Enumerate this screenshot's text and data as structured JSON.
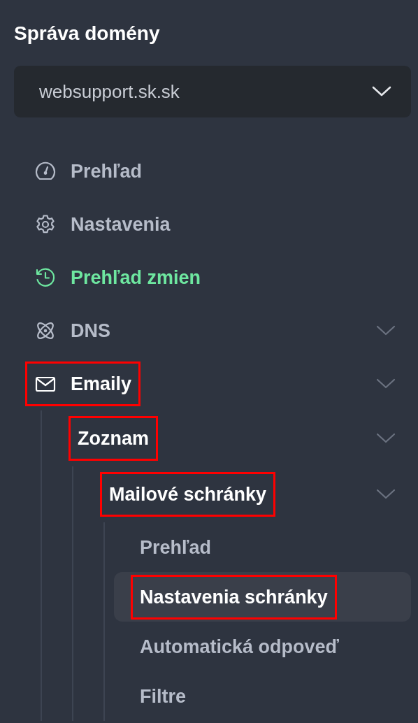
{
  "title": "Správa domény",
  "domain_select": {
    "value": "websupport.sk.sk"
  },
  "nav": {
    "items": [
      {
        "label": "Prehľad",
        "active": false,
        "expandable": false,
        "highlighted": false
      },
      {
        "label": "Nastavenia",
        "active": false,
        "expandable": false,
        "highlighted": false
      },
      {
        "label": "Prehľad zmien",
        "active": true,
        "expandable": false,
        "highlighted": false
      },
      {
        "label": "DNS",
        "active": false,
        "expandable": true,
        "highlighted": false
      },
      {
        "label": "Emaily",
        "active": false,
        "expandable": true,
        "highlighted": true,
        "children": [
          {
            "label": "Zoznam",
            "expandable": true,
            "highlighted": true,
            "children": [
              {
                "label": "Mailové schránky",
                "expandable": true,
                "highlighted": true,
                "children": [
                  {
                    "label": "Prehľad",
                    "selected": false,
                    "highlighted": false
                  },
                  {
                    "label": "Nastavenia schránky",
                    "selected": true,
                    "highlighted": true
                  },
                  {
                    "label": "Automatická odpoveď",
                    "selected": false,
                    "highlighted": false
                  },
                  {
                    "label": "Filtre",
                    "selected": false,
                    "highlighted": false
                  }
                ]
              }
            ]
          }
        ]
      }
    ]
  }
}
